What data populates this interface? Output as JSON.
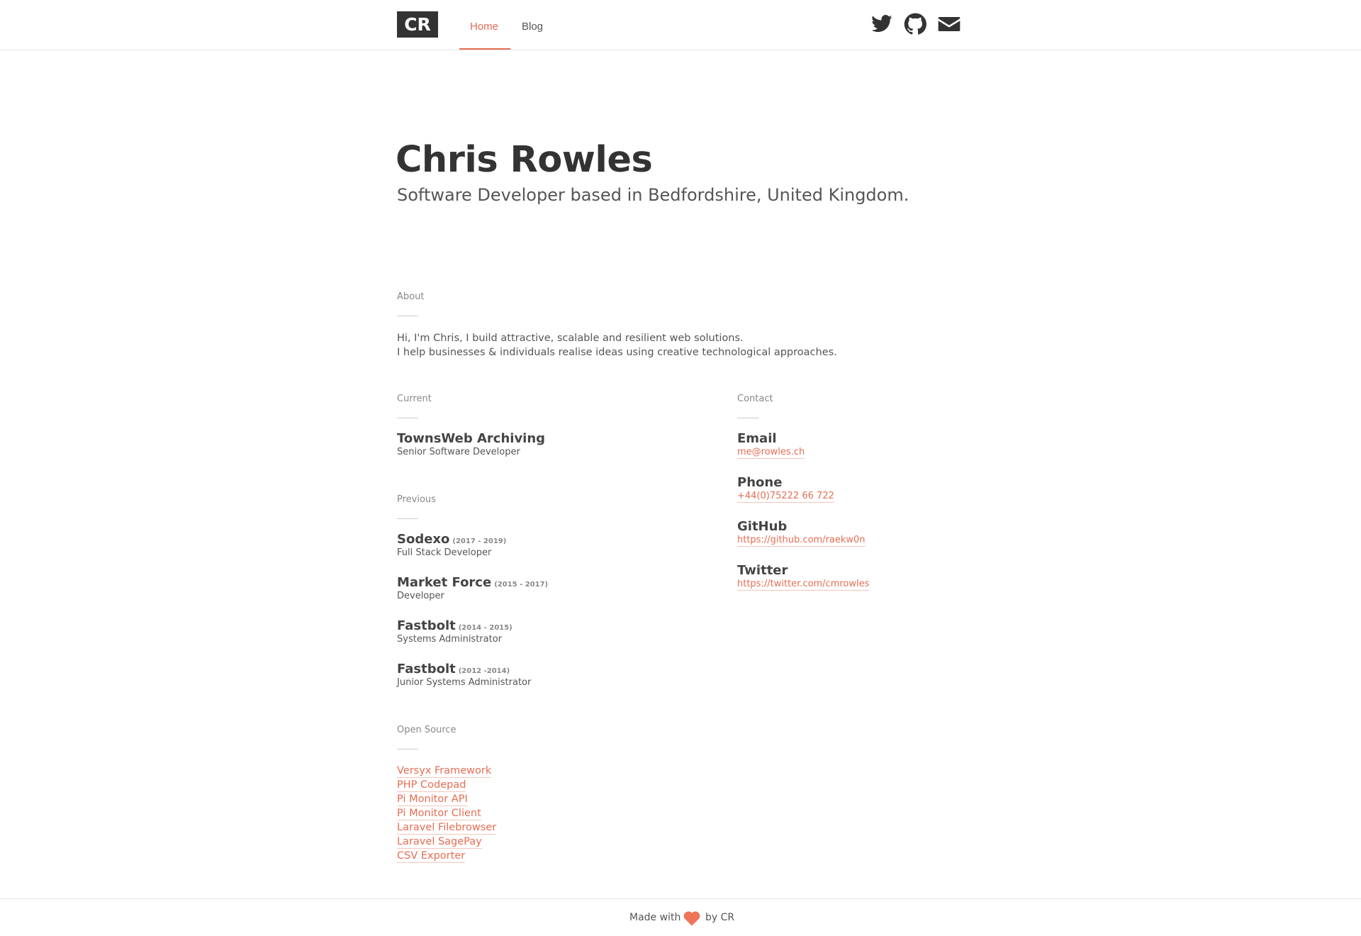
{
  "header": {
    "logo": "CR",
    "nav": [
      {
        "label": "Home",
        "active": true
      },
      {
        "label": "Blog",
        "active": false
      }
    ],
    "social_icons": [
      "twitter-icon",
      "github-icon",
      "email-icon"
    ]
  },
  "hero": {
    "name": "Chris Rowles",
    "subtitle": "Software Developer based in Bedfordshire, United Kingdom."
  },
  "about": {
    "label": "About",
    "lines": [
      "Hi, I'm Chris, I build attractive, scalable and resilient web solutions.",
      "I help businesses & individuals realise ideas using creative technological approaches."
    ]
  },
  "current": {
    "label": "Current",
    "company": "TownsWeb Archiving",
    "role": "Senior Software Developer"
  },
  "previous": {
    "label": "Previous",
    "jobs": [
      {
        "company": "Sodexo",
        "years": "(2017 - 2019)",
        "role": "Full Stack Developer"
      },
      {
        "company": "Market Force",
        "years": "(2015 - 2017)",
        "role": "Developer"
      },
      {
        "company": "Fastbolt",
        "years": "(2014 - 2015)",
        "role": "Systems Administrator"
      },
      {
        "company": "Fastbolt",
        "years": "(2012 -2014)",
        "role": "Junior Systems Administrator"
      }
    ]
  },
  "contact": {
    "label": "Contact",
    "items": [
      {
        "title": "Email",
        "value": "me@rowles.ch"
      },
      {
        "title": "Phone",
        "value": "+44(0)75222 66 722"
      },
      {
        "title": "GitHub",
        "value": "https://github.com/raekw0n"
      },
      {
        "title": "Twitter",
        "value": "https://twitter.com/cmrowles"
      }
    ]
  },
  "open_source": {
    "label": "Open Source",
    "links": [
      "Versyx Framework",
      "PHP Codepad",
      "Pi Monitor API",
      "Pi Monitor Client",
      "Laravel Filebrowser",
      "Laravel SagePay",
      "CSV Exporter"
    ]
  },
  "footer": {
    "made_with": "Made with",
    "by": "by CR",
    "heart_color": "#f0745a"
  },
  "colors": {
    "accent": "#e56d53",
    "text": "#333333"
  }
}
